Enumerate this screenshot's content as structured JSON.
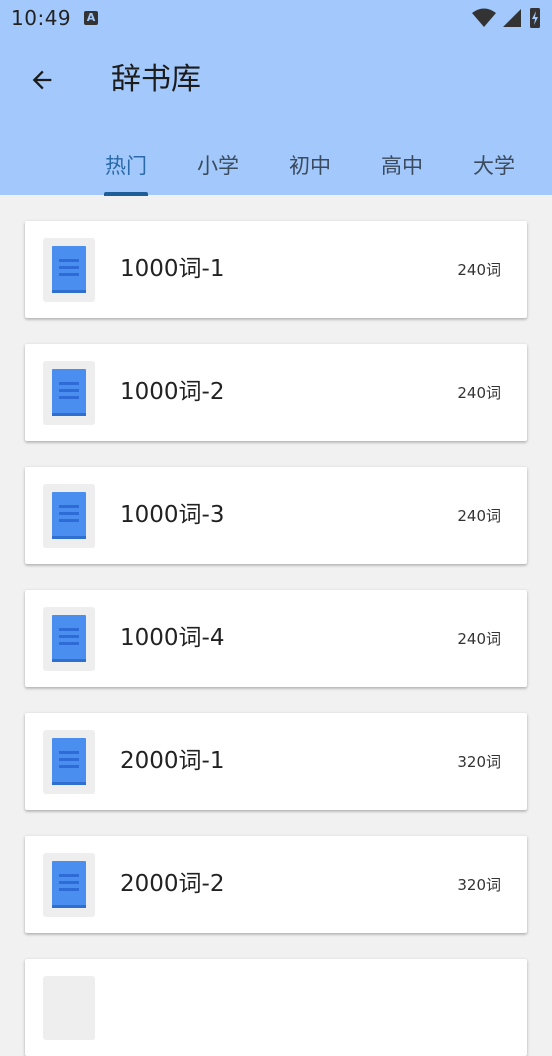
{
  "status": {
    "time": "10:49",
    "notif_icon": "A"
  },
  "appbar": {
    "title": "辞书库",
    "back_icon": "arrow-left-icon"
  },
  "tabs": [
    {
      "label": "热门",
      "active": true
    },
    {
      "label": "小学",
      "active": false
    },
    {
      "label": "初中",
      "active": false
    },
    {
      "label": "高中",
      "active": false
    },
    {
      "label": "大学",
      "active": false
    }
  ],
  "books": [
    {
      "name": "1000词-1",
      "count": "240词"
    },
    {
      "name": "1000词-2",
      "count": "240词"
    },
    {
      "name": "1000词-3",
      "count": "240词"
    },
    {
      "name": "1000词-4",
      "count": "240词"
    },
    {
      "name": "2000词-1",
      "count": "320词"
    },
    {
      "name": "2000词-2",
      "count": "320词"
    },
    {
      "name": "",
      "count": ""
    }
  ],
  "colors": {
    "header": "#a3c9fc",
    "accent": "#1f5f99",
    "book": "#4a8ef0"
  }
}
